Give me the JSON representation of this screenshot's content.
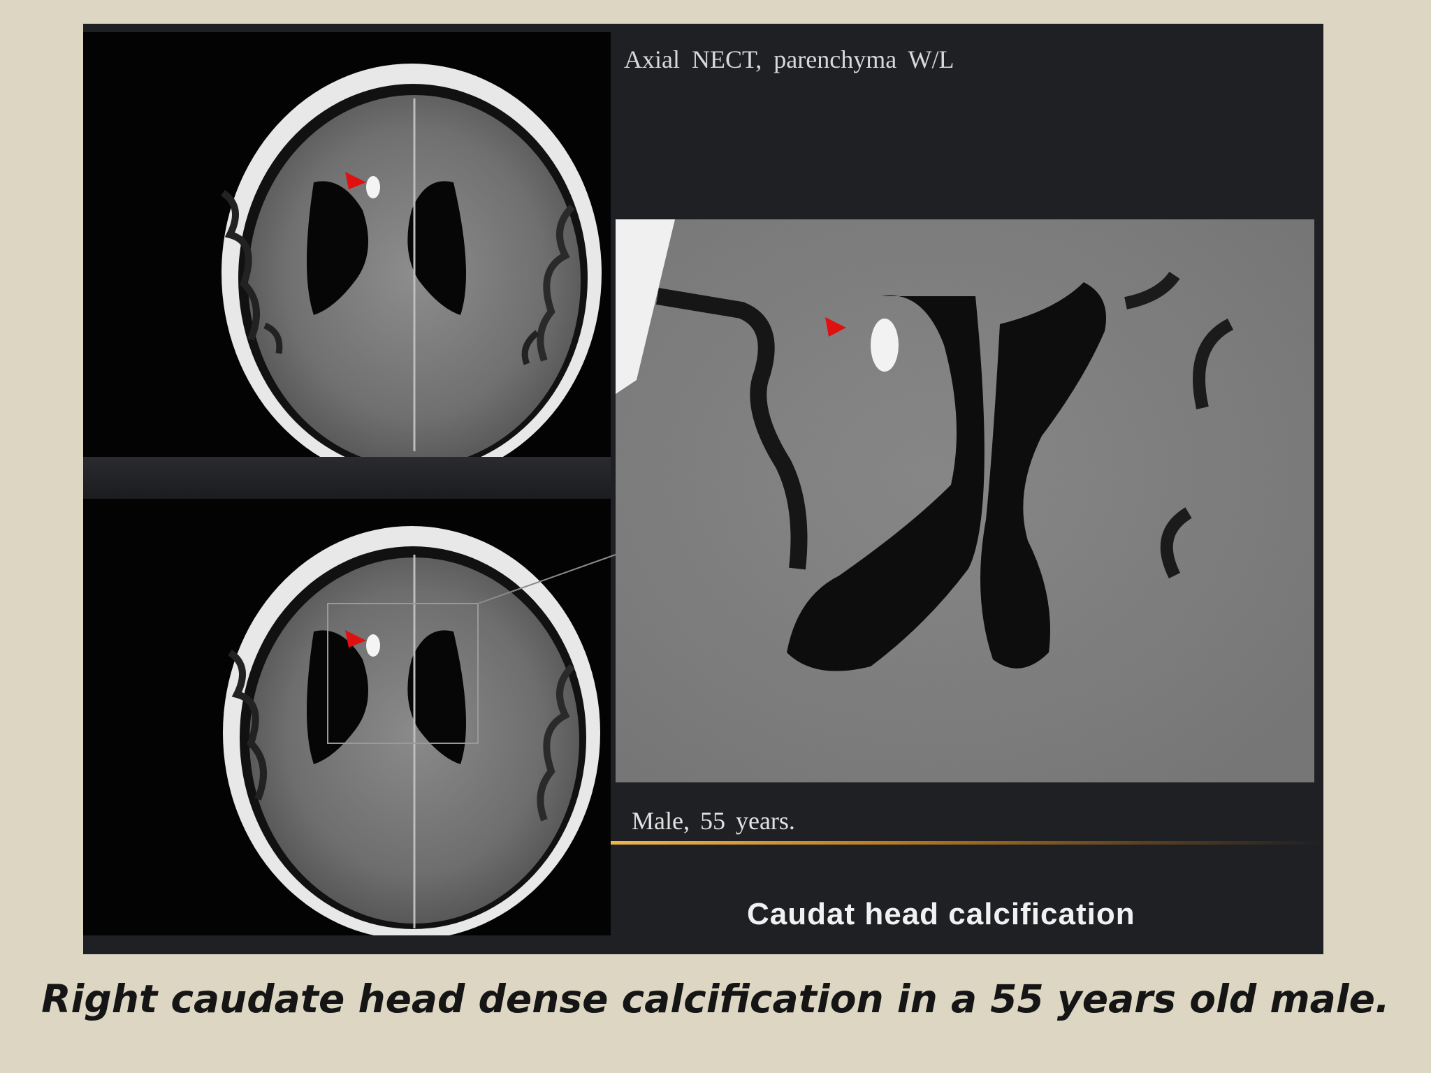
{
  "images": {
    "header_label": "Axial NECT,  parenchyma  W/L",
    "patient_label": "Male,  55 years.",
    "bottom_title": "Caudat head calcification",
    "caption": "Right caudate head dense calcification in a 55 years old male.",
    "annotation_color": "#e01010",
    "accent_line_color": "#f0b54c",
    "background_color": "#dcd6c3"
  }
}
